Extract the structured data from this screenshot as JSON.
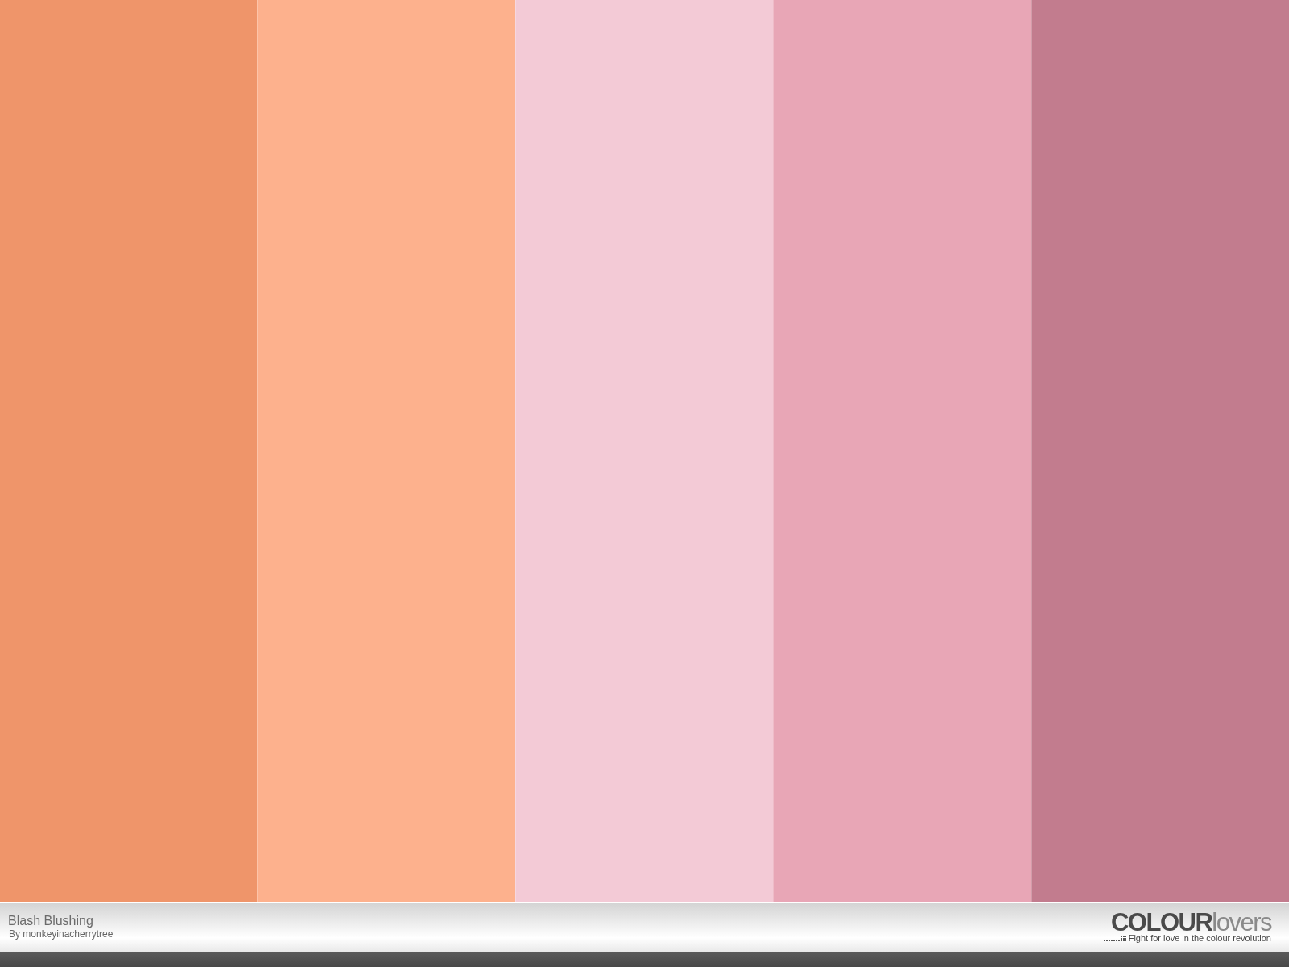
{
  "swatches": [
    {
      "color": "#ef956a"
    },
    {
      "color": "#fdb18d"
    },
    {
      "color": "#f3cad6"
    },
    {
      "color": "#e8a6b6"
    },
    {
      "color": "#c27c8e"
    }
  ],
  "palette": {
    "title": "Blash Blushing",
    "author": "By monkeyinacherrytree"
  },
  "logo": {
    "strong": "COLOUR",
    "light": "lovers",
    "tagline": "Fight for love in the colour revolution"
  }
}
